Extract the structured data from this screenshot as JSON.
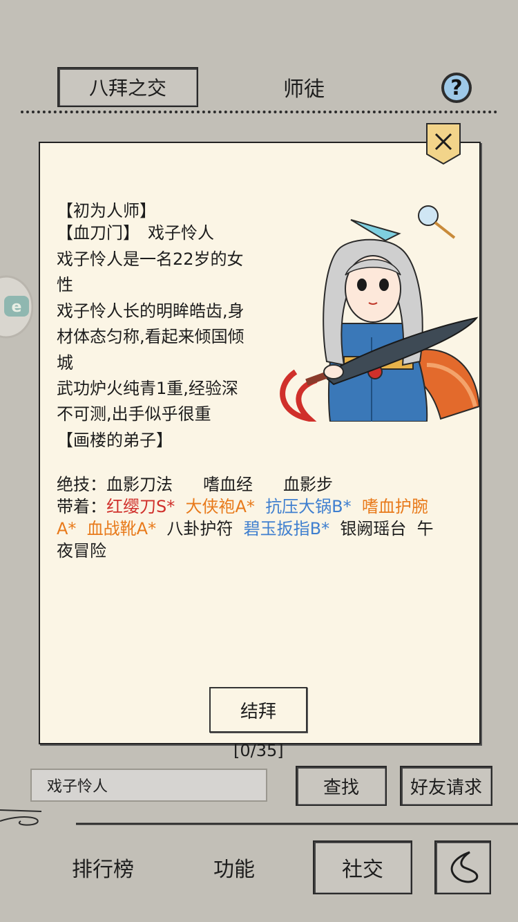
{
  "tabs": {
    "sworn": "八拜之交",
    "mentor": "师徒"
  },
  "dialog": {
    "lines": [
      "【初为人师】",
      "【血刀门】　戏子怜人",
      "戏子怜人是一名22岁的女",
      "性",
      "戏子怜人长的明眸皓齿,身",
      "材体态匀称,看起来倾国倾",
      "城",
      "武功炉火纯青1重,经验深",
      "不可测,出手似乎很重",
      "【画楼的弟子】"
    ],
    "skills_label": "绝技：",
    "skills": [
      "血影刀法",
      "嗜血经",
      "血影步"
    ],
    "equip_label": "带着：",
    "equipment": [
      {
        "name": "红缨刀S*",
        "color": "#d0302b"
      },
      {
        "name": "大侠袍A*",
        "color": "#e87a1b"
      },
      {
        "name": "抗压大锅B*",
        "color": "#3f7fcf"
      },
      {
        "name": "嗜血护腕A*",
        "color": "#e87a1b"
      },
      {
        "name": "血战靴A*",
        "color": "#e87a1b"
      },
      {
        "name": "八卦护符",
        "color": "#1d1d1d"
      },
      {
        "name": "碧玉扳指B*",
        "color": "#3f7fcf"
      },
      {
        "name": "银阙瑶台",
        "color": "#1d1d1d"
      },
      {
        "name": "午夜冒险",
        "color": "#1d1d1d"
      }
    ],
    "equip_wrap": {
      "row1_tail": "嗜血护腕",
      "row2_head": "A*",
      "row3_tail": "午",
      "row4_head": "夜冒险"
    },
    "bind_button": "结拜"
  },
  "counter": "[0/35]",
  "search": {
    "value": "戏子怜人",
    "find_button": "查找",
    "friend_request_button": "好友请求"
  },
  "bottom_nav": {
    "ranking": "排行榜",
    "functions": "功能",
    "social": "社交"
  }
}
